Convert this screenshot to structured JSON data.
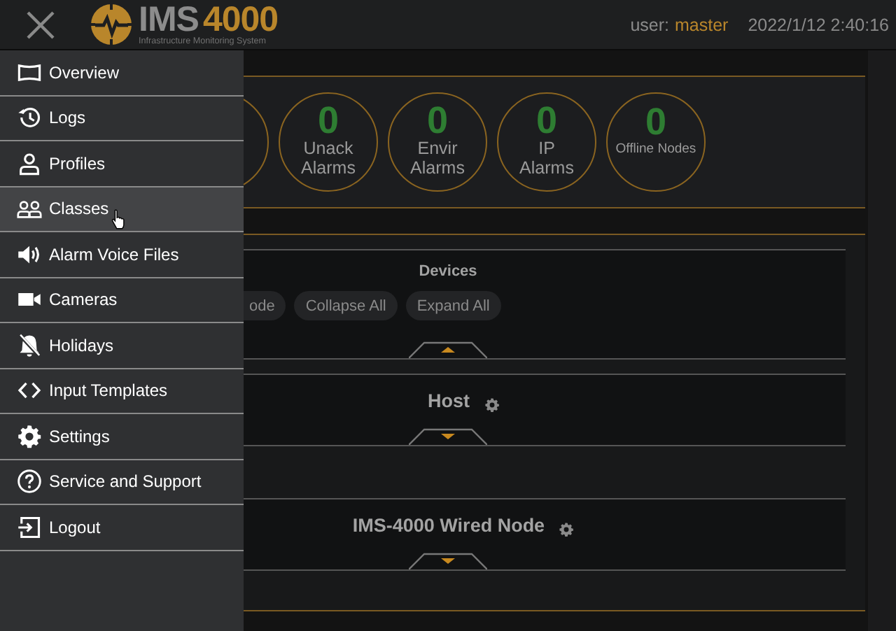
{
  "header": {
    "logo": {
      "name": "IMS",
      "number": "4000",
      "tagline": "Infrastructure Monitoring System"
    },
    "user_label": "user:",
    "user_name": "master",
    "datetime": "2022/1/12 2:40:16"
  },
  "menu": [
    {
      "label": "Overview",
      "kind": "overview",
      "hovered": false
    },
    {
      "label": "Logs",
      "kind": "logs",
      "hovered": false
    },
    {
      "label": "Profiles",
      "kind": "profiles",
      "hovered": false
    },
    {
      "label": "Classes",
      "kind": "classes",
      "hovered": true
    },
    {
      "label": "Alarm Voice Files",
      "kind": "audio",
      "hovered": false
    },
    {
      "label": "Cameras",
      "kind": "cameras",
      "hovered": false
    },
    {
      "label": "Holidays",
      "kind": "holidays",
      "hovered": false
    },
    {
      "label": "Input Templates",
      "kind": "templates",
      "hovered": false
    },
    {
      "label": "Settings",
      "kind": "settings",
      "hovered": false
    },
    {
      "label": "Service and Support",
      "kind": "support",
      "hovered": false
    },
    {
      "label": "Logout",
      "kind": "logout",
      "hovered": false
    }
  ],
  "stats": [
    {
      "count": "0",
      "label": "Unack\nAlarms"
    },
    {
      "count": "0",
      "label": "Envir\nAlarms"
    },
    {
      "count": "0",
      "label": "IP\nAlarms"
    },
    {
      "count": "0",
      "label": "Offline Nodes"
    }
  ],
  "devices": {
    "title": "Devices",
    "buttons": [
      "ode",
      "Collapse All",
      "Expand All"
    ],
    "expanded": true
  },
  "sections": [
    {
      "title": "Host",
      "expanded": false
    },
    {
      "title": "IMS-4000 Wired Node",
      "expanded": false
    }
  ]
}
